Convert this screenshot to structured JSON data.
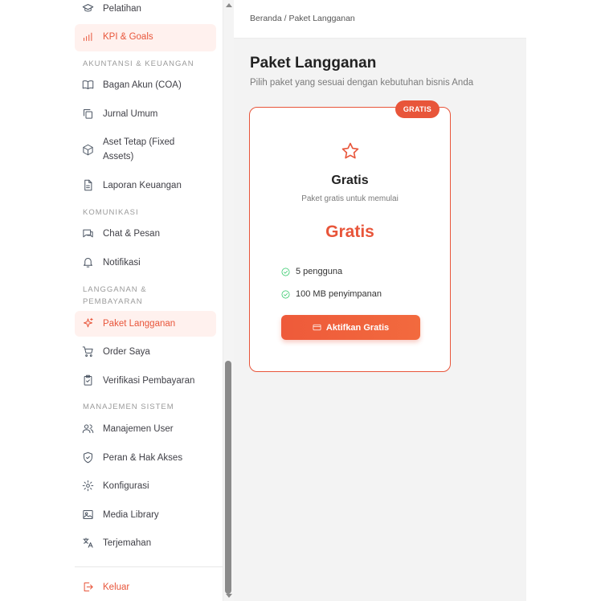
{
  "sidebar": {
    "items": [
      {
        "label": "Pelatihan",
        "icon": "graduation-cap-icon"
      },
      {
        "label": "KPI & Goals",
        "icon": "bar-chart-icon"
      },
      {
        "label": "Bagan Akun (COA)",
        "icon": "book-icon"
      },
      {
        "label": "Jurnal Umum",
        "icon": "copy-icon"
      },
      {
        "label": "Aset Tetap (Fixed Assets)",
        "icon": "cube-icon"
      },
      {
        "label": "Laporan Keuangan",
        "icon": "file-text-icon"
      },
      {
        "label": "Chat & Pesan",
        "icon": "chat-icon"
      },
      {
        "label": "Notifikasi",
        "icon": "bell-icon"
      },
      {
        "label": "Paket Langganan",
        "icon": "sparkles-icon"
      },
      {
        "label": "Order Saya",
        "icon": "cart-icon"
      },
      {
        "label": "Verifikasi Pembayaran",
        "icon": "clipboard-check-icon"
      },
      {
        "label": "Manajemen User",
        "icon": "users-icon"
      },
      {
        "label": "Peran & Hak Akses",
        "icon": "shield-check-icon"
      },
      {
        "label": "Konfigurasi",
        "icon": "gear-icon"
      },
      {
        "label": "Media Library",
        "icon": "image-icon"
      },
      {
        "label": "Terjemahan",
        "icon": "translate-icon"
      }
    ],
    "sections": [
      "AKUNTANSI & KEUANGAN",
      "KOMUNIKASI",
      "LANGGANAN & PEMBAYARAN",
      "MANAJEMEN SISTEM"
    ],
    "logout": {
      "label": "Keluar",
      "icon": "logout-icon"
    }
  },
  "header": {
    "breadcrumb": "Beranda / Paket Langganan"
  },
  "main": {
    "title": "Paket Langganan",
    "subtitle": "Pilih paket yang sesuai dengan kebutuhan bisnis Anda",
    "plan": {
      "badge": "GRATIS",
      "icon": "star-icon",
      "name": "Gratis",
      "description": "Paket gratis untuk memulai",
      "price": "Gratis",
      "features": [
        "5 pengguna",
        "100 MB penyimpanan"
      ],
      "button_label": "Aktifkan Gratis"
    }
  },
  "colors": {
    "accent": "#e8553a",
    "active_bg": "#fff1ee",
    "check": "#22c55e"
  }
}
